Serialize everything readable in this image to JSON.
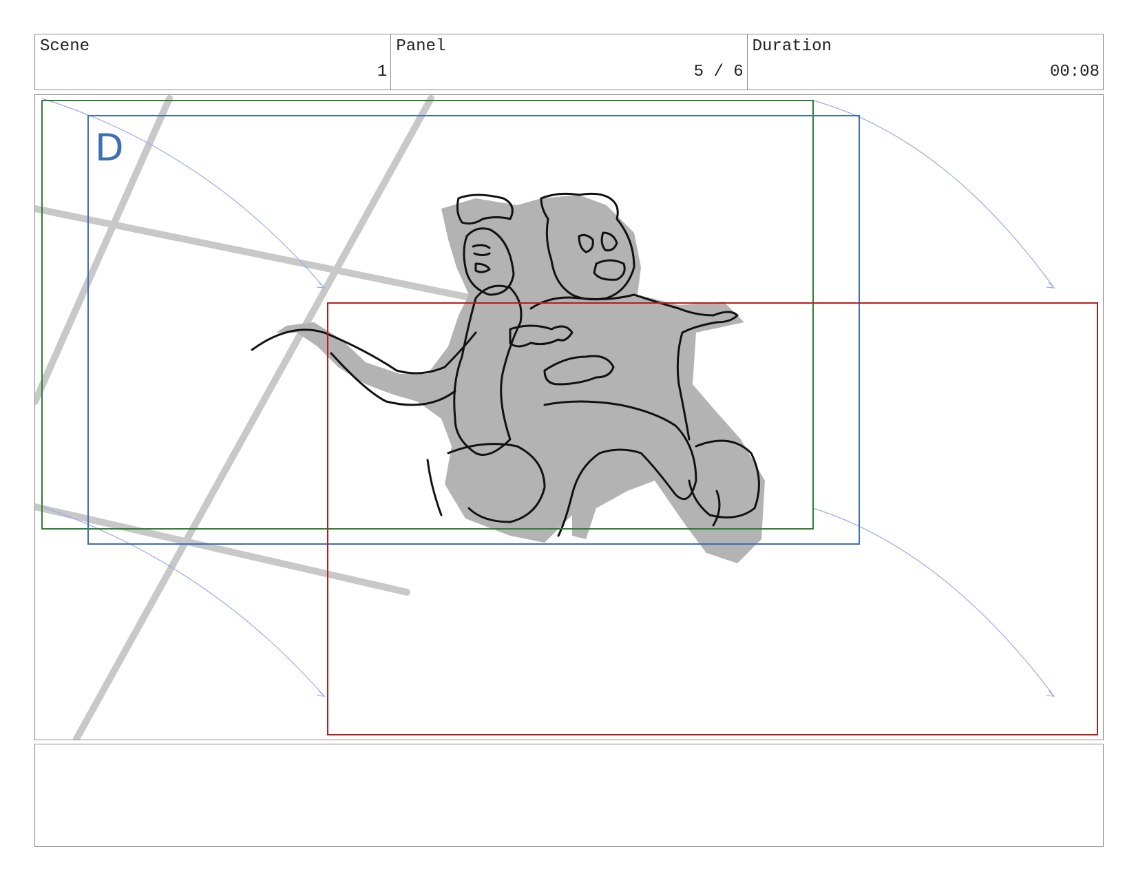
{
  "header": {
    "scene": {
      "label": "Scene",
      "value": "1"
    },
    "panel": {
      "label": "Panel",
      "value": "5 / 6"
    },
    "duration": {
      "label": "Duration",
      "value": "00:08"
    }
  },
  "panel": {
    "frame_label": "D",
    "colors": {
      "frame_start": "#2e7d32",
      "frame_mid": "#3b6fb6",
      "frame_end": "#b71c1c",
      "motion_path": "#9fa8e8",
      "bg_lines": "#c8c8c8",
      "character_fill": "#b3b3b3",
      "ink": "#111111"
    }
  },
  "notes": {
    "text": ""
  }
}
